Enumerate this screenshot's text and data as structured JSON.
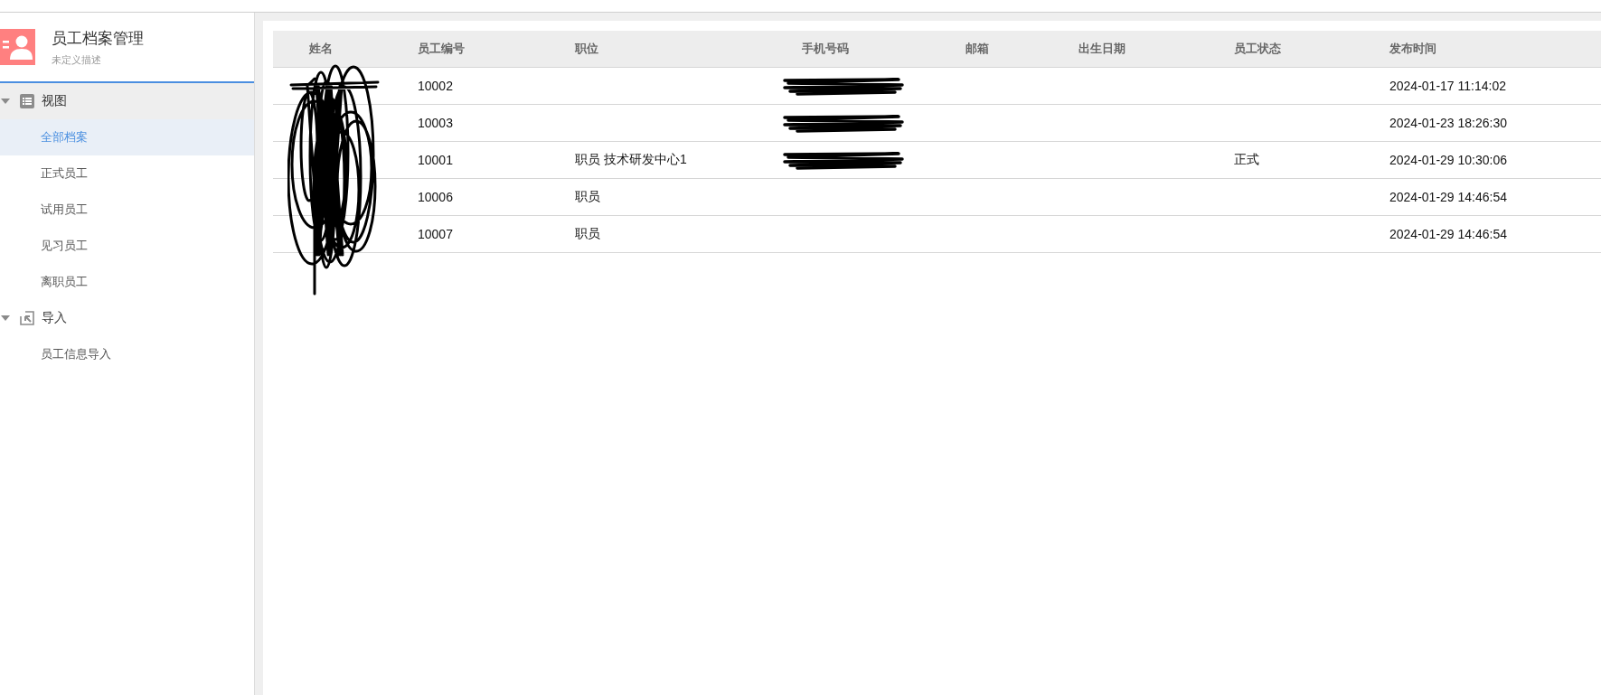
{
  "sidebar": {
    "title": "员工档案管理",
    "subtitle": "未定义描述",
    "groups": [
      {
        "label": "视图",
        "kind": "view",
        "expanded": true,
        "active": true,
        "items": [
          {
            "label": "全部档案",
            "selected": true
          },
          {
            "label": "正式员工",
            "selected": false
          },
          {
            "label": "试用员工",
            "selected": false
          },
          {
            "label": "见习员工",
            "selected": false
          },
          {
            "label": "离职员工",
            "selected": false
          }
        ]
      },
      {
        "label": "导入",
        "kind": "import",
        "expanded": true,
        "active": false,
        "items": [
          {
            "label": "员工信息导入",
            "selected": false
          }
        ]
      }
    ]
  },
  "table": {
    "columns": [
      "姓名",
      "员工编号",
      "职位",
      "手机号码",
      "邮箱",
      "出生日期",
      "员工状态",
      "发布时间"
    ],
    "names_redacted": true,
    "rows": [
      {
        "employee_no": "10002",
        "phone_redacted": true,
        "published": "2024-01-17 11:14:02"
      },
      {
        "employee_no": "10003",
        "phone_redacted": true,
        "published": "2024-01-23 18:26:30"
      },
      {
        "employee_no": "10001",
        "position": "职员 技术研发中心1",
        "phone_redacted": true,
        "status": "正式",
        "published": "2024-01-29 10:30:06"
      },
      {
        "employee_no": "10006",
        "position": "职员",
        "phone_redacted": false,
        "published": "2024-01-29 14:46:54"
      },
      {
        "employee_no": "10007",
        "position": "职员",
        "phone_redacted": false,
        "published": "2024-01-29 14:46:54"
      }
    ]
  }
}
